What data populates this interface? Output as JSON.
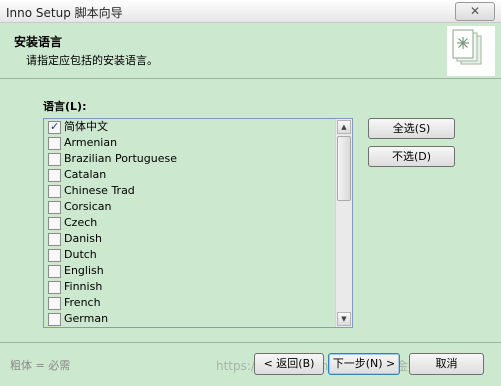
{
  "window": {
    "title": "Inno Setup 脚本向导",
    "close_label": "✕"
  },
  "header": {
    "title": "安装语言",
    "subtitle": "请指定应包括的安装语言。",
    "image_icon": "setup-pages-icon"
  },
  "languages": {
    "label": "语言(L):",
    "items": [
      {
        "label": "简体中文",
        "checked": true
      },
      {
        "label": "Armenian",
        "checked": false
      },
      {
        "label": "Brazilian Portuguese",
        "checked": false
      },
      {
        "label": "Catalan",
        "checked": false
      },
      {
        "label": "Chinese Trad",
        "checked": false
      },
      {
        "label": "Corsican",
        "checked": false
      },
      {
        "label": "Czech",
        "checked": false
      },
      {
        "label": "Danish",
        "checked": false
      },
      {
        "label": "Dutch",
        "checked": false
      },
      {
        "label": "English",
        "checked": false
      },
      {
        "label": "Finnish",
        "checked": false
      },
      {
        "label": "French",
        "checked": false
      },
      {
        "label": "German",
        "checked": false
      }
    ],
    "select_all_label": "全选(S)",
    "deselect_label": "不选(D)"
  },
  "footer": {
    "note": "粗体 = 必需",
    "back_label": "< 返回(B)",
    "next_label": "下一步(N) >",
    "cancel_label": "取消",
    "watermark": "https://blog.csdn.net/  @稀土掘金技术社区"
  },
  "colors": {
    "background": "#cce8cf",
    "list_border": "#7f9db9",
    "check": "#1b3a8c"
  }
}
